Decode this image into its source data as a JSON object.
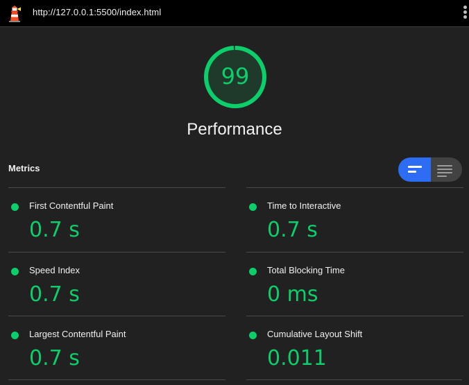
{
  "toolbar": {
    "url": "http://127.0.0.1:5500/index.html"
  },
  "score": {
    "value": "99",
    "fraction": 0.99,
    "color": "#0cce6b",
    "category": "Performance"
  },
  "metrics": {
    "heading": "Metrics",
    "items": [
      {
        "label": "First Contentful Paint",
        "value": "0.7 s"
      },
      {
        "label": "Time to Interactive",
        "value": "0.7 s"
      },
      {
        "label": "Speed Index",
        "value": "0.7 s"
      },
      {
        "label": "Total Blocking Time",
        "value": "0 ms"
      },
      {
        "label": "Largest Contentful Paint",
        "value": "0.7 s"
      },
      {
        "label": "Cumulative Layout Shift",
        "value": "0.011"
      }
    ]
  },
  "colors": {
    "pass": "#0cce6b",
    "toggle_active": "#2d6cf5",
    "background": "#212121"
  }
}
